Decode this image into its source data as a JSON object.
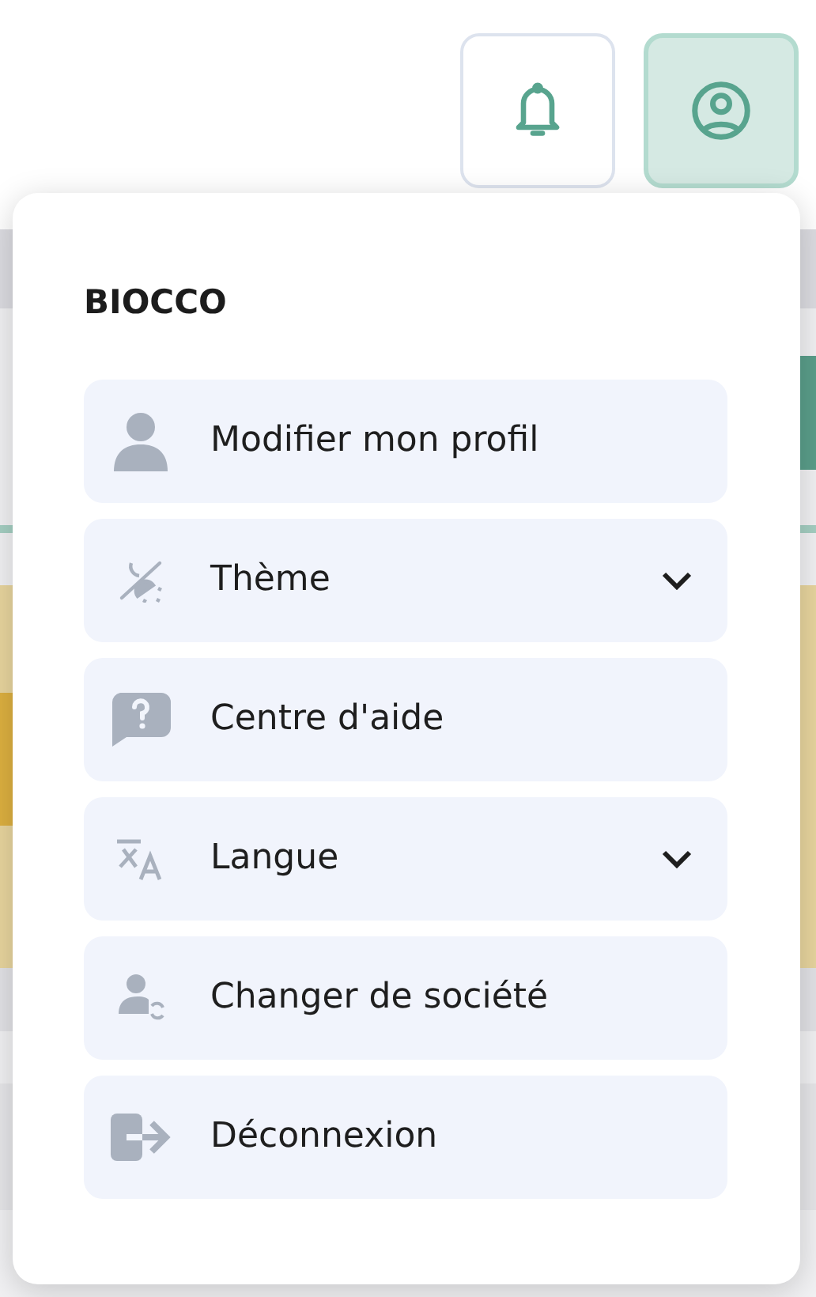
{
  "header_buttons": [
    {
      "selected": false
    },
    {
      "selected": true
    }
  ],
  "menu": {
    "title": "BIOCCO",
    "items": [
      {
        "label": "Modifier mon profil",
        "kind": "action"
      },
      {
        "label": "Thème",
        "kind": "submenu"
      },
      {
        "label": "Centre d'aide",
        "kind": "action"
      },
      {
        "label": "Langue",
        "kind": "submenu"
      },
      {
        "label": "Changer de société",
        "kind": "action"
      },
      {
        "label": "Déconnexion",
        "kind": "action"
      }
    ]
  }
}
